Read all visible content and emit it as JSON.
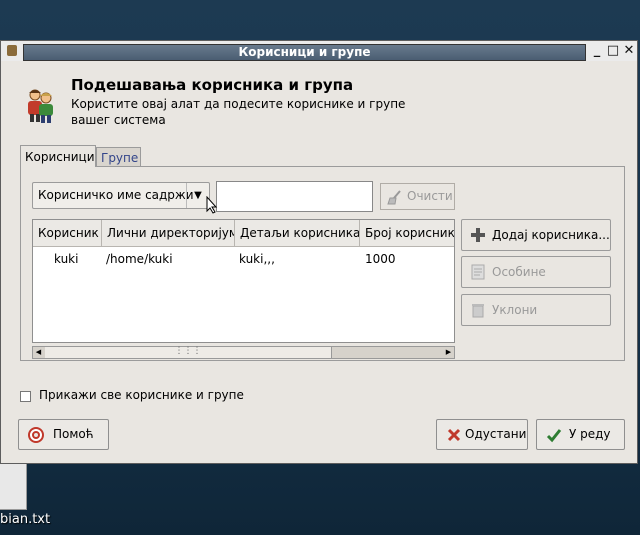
{
  "desktop": {
    "file_label": "bian.txt"
  },
  "window": {
    "title": "Корисници и групе",
    "controls": {
      "minimize": "_",
      "maximize": "□",
      "close": "✕"
    }
  },
  "header": {
    "title": "Подешавања корисника и група",
    "subtitle": "Користите овај алат да подесите кориснике и групе вашег система"
  },
  "tabs": [
    {
      "label": "Корисници",
      "active": true
    },
    {
      "label": "Групе",
      "active": false
    }
  ],
  "filter": {
    "combo_value": "Корисничко име садржи",
    "search_value": "",
    "clear_label": "Очисти"
  },
  "table": {
    "columns": [
      "Корисник",
      "Лични директоријум",
      "Детаљи корисника",
      "Број корисника"
    ],
    "rows": [
      [
        "kuki",
        "/home/kuki",
        "kuki,,,",
        "1000"
      ]
    ]
  },
  "actions": {
    "add_label": "Додај корисника...",
    "properties_label": "Особине",
    "remove_label": "Уклони"
  },
  "show_all_label": "Прикажи све кориснике и групе",
  "buttons": {
    "help": "Помоћ",
    "cancel": "Одустани",
    "ok": "У реду"
  },
  "colors": {
    "window_bg": "#e9e6e1",
    "title_strip": "#4a5d72",
    "tab_inactive_text": "#33458a"
  }
}
